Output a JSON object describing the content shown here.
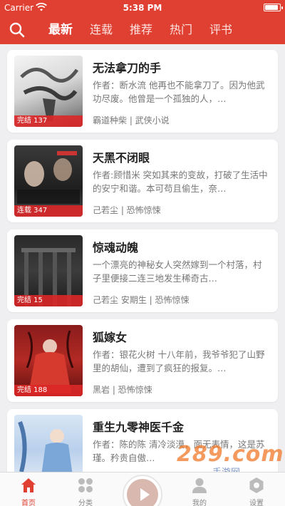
{
  "status": {
    "carrier": "Carrier",
    "time": "5:38 PM"
  },
  "header": {
    "tabs": [
      "最新",
      "连载",
      "推荐",
      "热门",
      "评书"
    ],
    "active_tab": 0
  },
  "books": [
    {
      "title": "无法拿刀的手",
      "desc": "作者：断水流 他再也不能拿刀了。因为他武功尽废。他曾是一个孤独的人，…",
      "meta": "霸道种柴 | 武侠小说",
      "badge": "完结 137"
    },
    {
      "title": "天黑不闭眼",
      "desc": "作者:顾惜米 突如其来的变故，打破了生活中的安宁和谐。本可苟且偷生，奈…",
      "meta": "己若尘 | 恐怖惊悚",
      "badge": "连载 347"
    },
    {
      "title": "惊魂动魄",
      "desc": "一个漂亮的神秘女人突然嫁到一个村落，村子里便接二连三地发生稀奇古…",
      "meta": "己若尘 安期生 | 恐怖惊悚",
      "badge": "完结 15"
    },
    {
      "title": "狐嫁女",
      "desc": "作者：银花火树 十八年前，我爷爷犯了山野里的胡仙，遭到了疯狂的报复。…",
      "meta": "黑岩 | 恐怖惊悚",
      "badge": "完结 188"
    },
    {
      "title": "重生九零神医千金",
      "desc": "作者：陈的陈 清冷淡漠，面无表情，这是苏瑾。矜贵自傲…",
      "meta": "",
      "badge": ""
    }
  ],
  "tabbar": [
    {
      "label": "首页",
      "icon": "home-icon"
    },
    {
      "label": "分类",
      "icon": "grid-icon"
    },
    {
      "label": "",
      "icon": "play-icon"
    },
    {
      "label": "我的",
      "icon": "user-icon"
    },
    {
      "label": "设置",
      "icon": "settings-icon"
    }
  ],
  "colors": {
    "brand": "#e04032"
  },
  "watermark": {
    "main": "289.com",
    "sub": "手游网"
  }
}
